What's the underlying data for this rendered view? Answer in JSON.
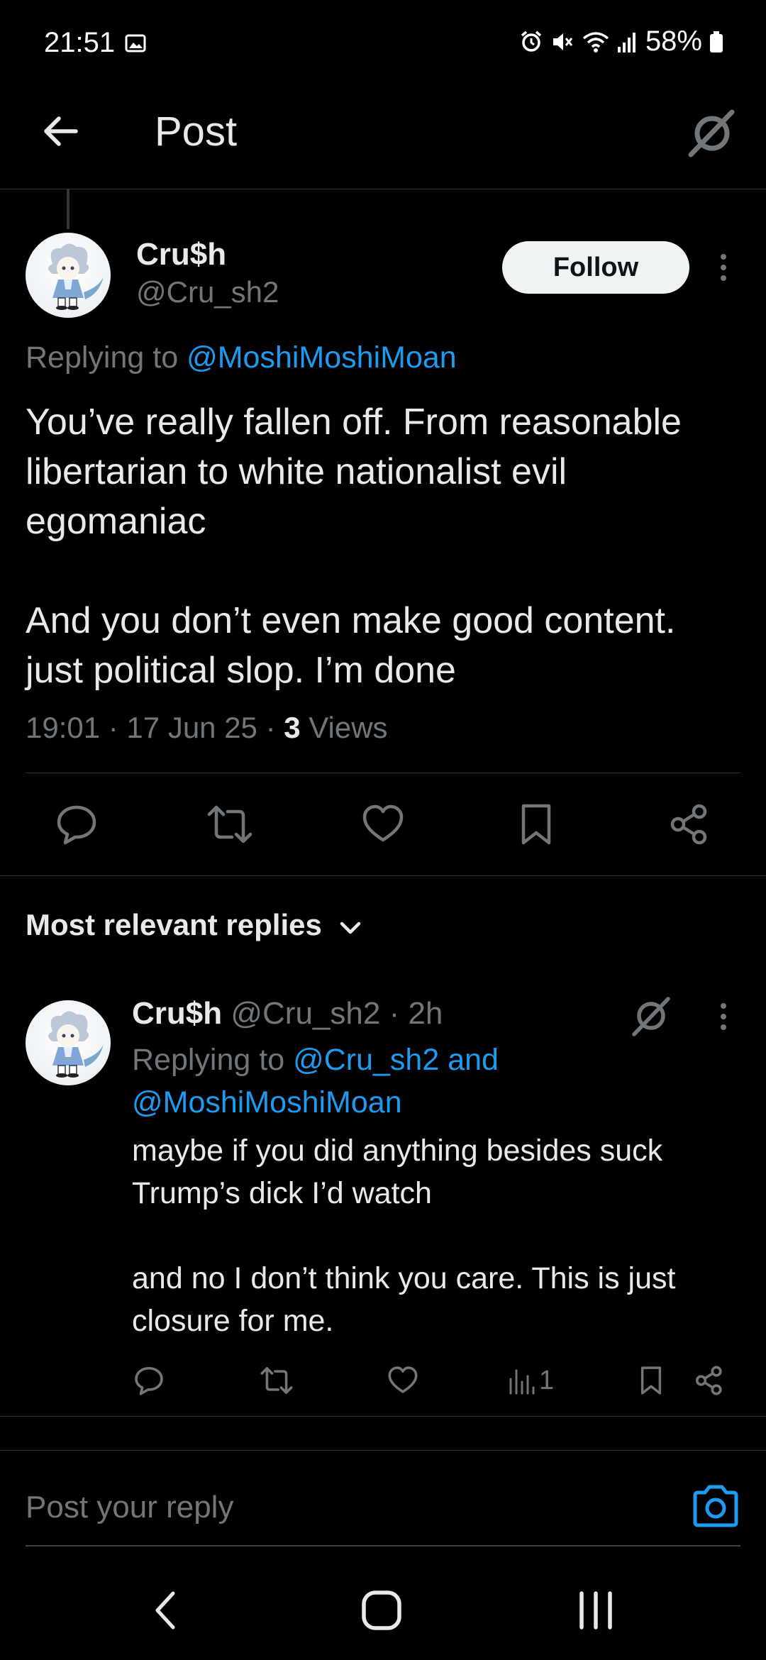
{
  "status_bar": {
    "time": "21:51",
    "battery": "58%",
    "icons": [
      "image-icon",
      "alarm-icon",
      "mute-icon",
      "wifi-icon",
      "signal-icon",
      "battery-icon"
    ]
  },
  "header": {
    "title": "Post"
  },
  "post": {
    "author_name": "Cru$h",
    "author_handle": "@Cru_sh2",
    "follow_label": "Follow",
    "replying_prefix": "Replying to ",
    "replying_to": "@MoshiMoshiMoan",
    "text": "You’ve really fallen off. From reasonable libertarian to white nationalist evil egomaniac\n\nAnd you don’t even make good content. just political slop. I’m done",
    "timestamp": "19:01 · 17 Jun 25 · ",
    "views_count": "3",
    "views_label": " Views"
  },
  "replies_sort": {
    "label": "Most relevant replies"
  },
  "reply": {
    "author_name": "Cru$h",
    "author_handle": "@Cru_sh2",
    "age": " · 2h",
    "replying_prefix": "Replying to ",
    "replying_to_1": "@Cru_sh2",
    "replying_joiner": " and ",
    "replying_to_2": "@MoshiMoshiMoan",
    "text": "maybe if you did anything besides suck Trump’s dick I’d watch\n\nand no I don’t think you care. This is just closure for me.",
    "views": "1"
  },
  "composer": {
    "placeholder": "Post your reply"
  },
  "colors": {
    "background": "#000000",
    "text": "#e7e9ea",
    "secondary_text": "#71767b",
    "link": "#1d9bf0",
    "divider": "#2f3336"
  }
}
